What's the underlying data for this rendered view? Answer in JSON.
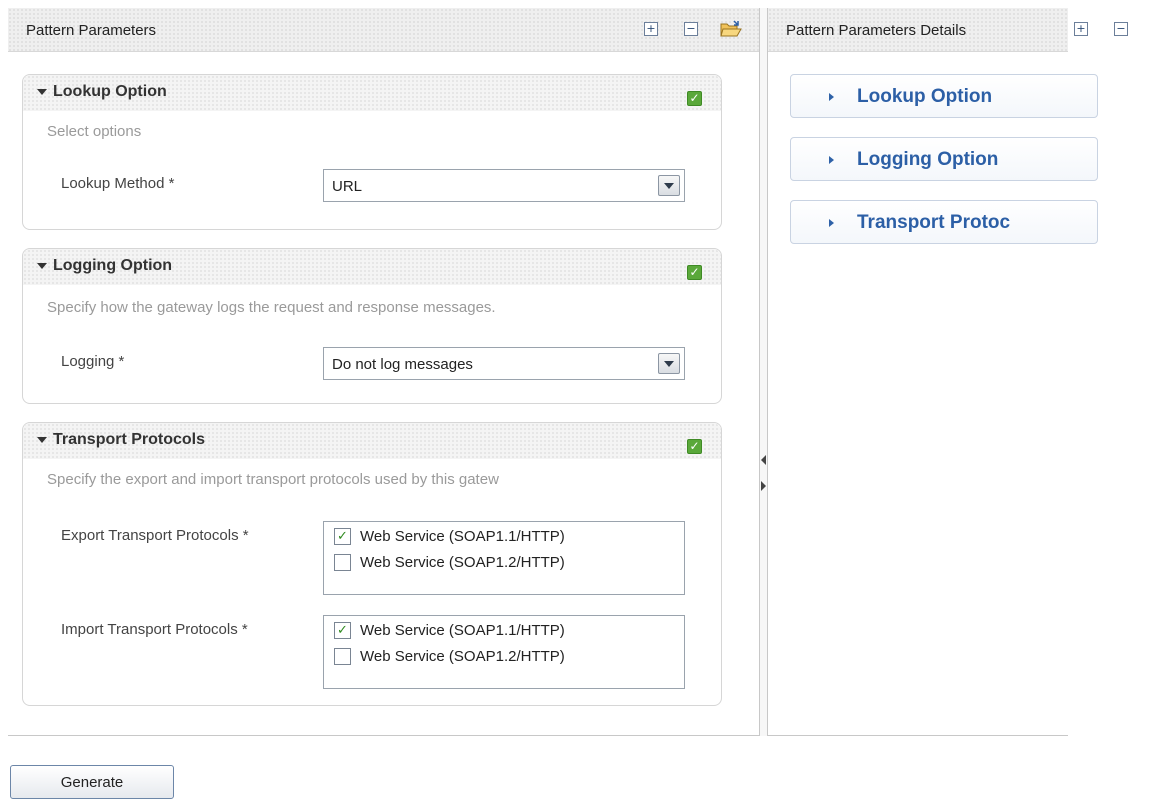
{
  "left_pane": {
    "title": "Pattern Parameters",
    "expand_all": "+",
    "collapse_all": "−"
  },
  "right_pane": {
    "title": "Pattern Parameters Details",
    "expand_all": "+",
    "collapse_all": "−",
    "items": [
      {
        "label": "Lookup Option"
      },
      {
        "label": "Logging Option"
      },
      {
        "label": "Transport Protoc"
      }
    ]
  },
  "sections": {
    "lookup": {
      "title": "Lookup Option",
      "description": "Select options",
      "field_label": "Lookup Method *",
      "value": "URL",
      "checked": true
    },
    "logging": {
      "title": "Logging Option",
      "description": "Specify how the gateway logs the request and response messages.",
      "field_label": "Logging *",
      "value": "Do not log messages",
      "checked": true
    },
    "transport": {
      "title": "Transport Protocols",
      "description": "Specify the export and import transport protocols used by this gatew",
      "export_label": "Export Transport Protocols *",
      "import_label": "Import Transport Protocols *",
      "export_options": [
        {
          "label": "Web Service (SOAP1.1/HTTP)",
          "checked": true
        },
        {
          "label": "Web Service (SOAP1.2/HTTP)",
          "checked": false
        }
      ],
      "import_options": [
        {
          "label": "Web Service (SOAP1.1/HTTP)",
          "checked": true
        },
        {
          "label": "Web Service (SOAP1.2/HTTP)",
          "checked": false
        }
      ],
      "checked": true
    }
  },
  "checkmark": "✓",
  "generate_label": "Generate",
  "icons": {
    "expand": "plus-box-icon",
    "collapse": "minus-box-icon",
    "open": "open-folder-icon",
    "section_toggle": "triangle-down-icon",
    "accordion": "triangle-right-icon",
    "dropdown": "chevron-down-icon"
  },
  "colors": {
    "accent": "#2c5fa6",
    "check_green": "#5aa83a"
  }
}
